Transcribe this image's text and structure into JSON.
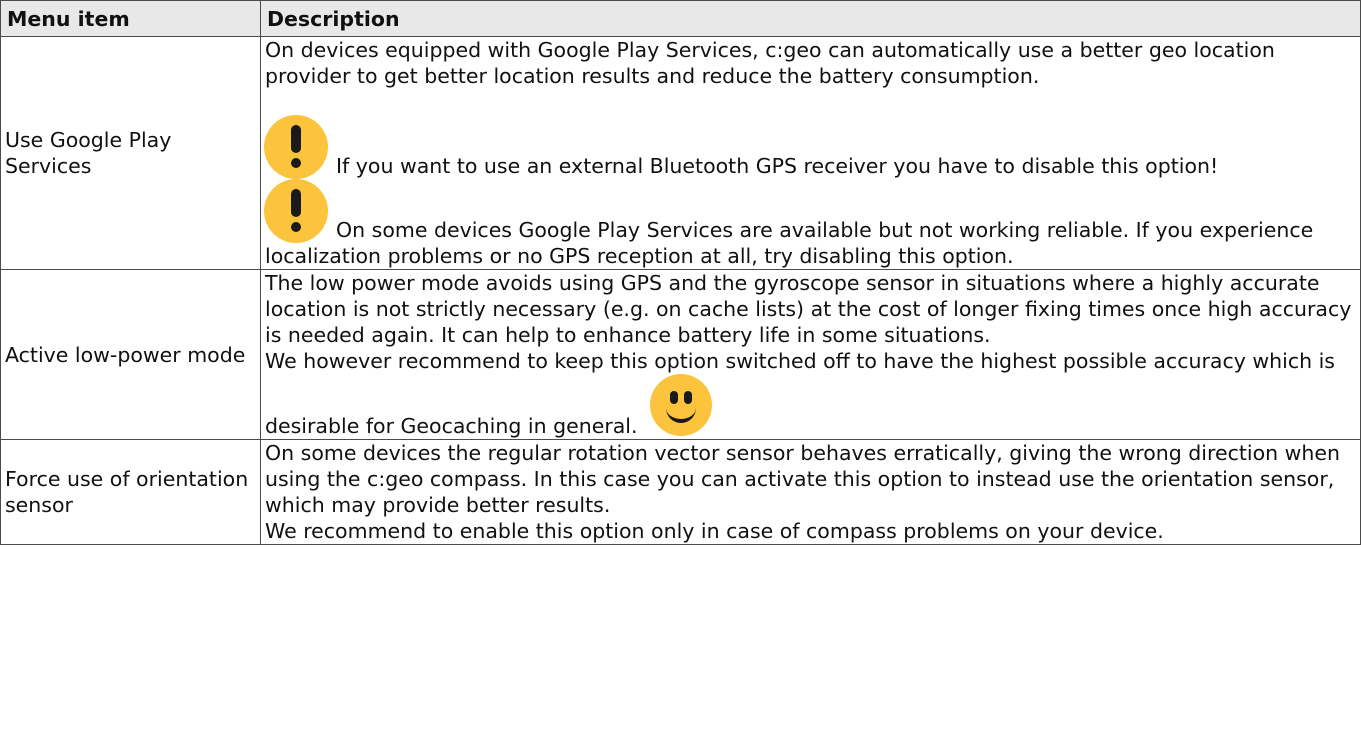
{
  "table": {
    "headers": {
      "menu_item": "Menu item",
      "description": "Description"
    },
    "rows": [
      {
        "item": "Use Google Play Services",
        "description": {
          "intro": "On devices equipped with Google Play Services, c:geo can automatically use a better geo location provider to get better location results and reduce the battery consumption.",
          "warning_1": "If you want to use an external Bluetooth GPS receiver you have to disable this option!",
          "warning_2": "On some devices Google Play Services are available but not working reliable. If you experience localization problems or no GPS reception at all, try disabling this option."
        }
      },
      {
        "item": "Active low-power mode",
        "description": {
          "intro": "The low power mode avoids using GPS and the gyroscope sensor in situations where a highly accurate location is not strictly necessary (e.g. on cache lists) at the cost of longer fixing times once high accuracy is needed again. It can help to enhance battery life in some situations.",
          "recommendation": "We however recommend to keep this option switched off to have the highest possible accuracy which is desirable for Geocaching in general."
        }
      },
      {
        "item": "Force use of orientation sensor",
        "description": {
          "intro": "On some devices the regular rotation vector sensor behaves erratically, giving the wrong direction when using the c:geo compass. In this case you can activate this option to instead use the orientation sensor, which may provide better results.",
          "recommendation": "We recommend to enable this option only in case of compass problems on your device."
        }
      }
    ]
  },
  "icons": {
    "warning": "exclamation-emoji",
    "smile": "smiley-emoji",
    "emoji_color": "#fcc43d"
  }
}
